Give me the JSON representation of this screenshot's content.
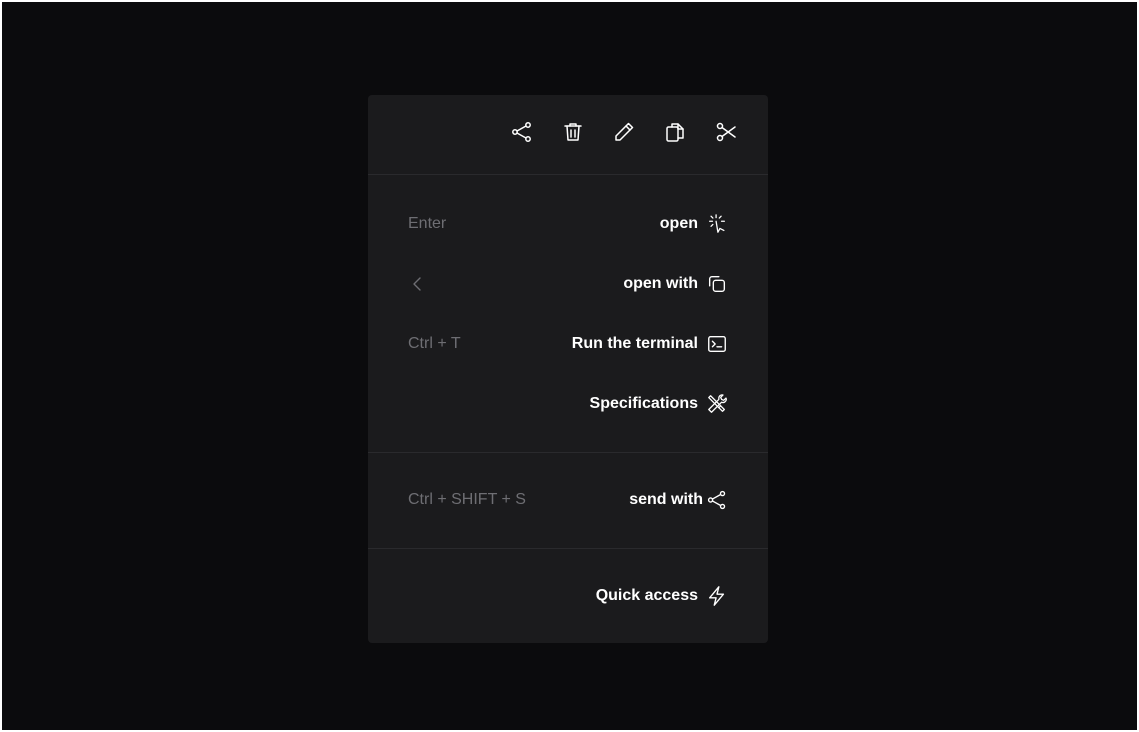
{
  "toolbar": {
    "icons": [
      "share-icon",
      "trash-icon",
      "pencil-icon",
      "copy-icon",
      "scissors-icon"
    ]
  },
  "section_open": {
    "items": [
      {
        "shortcut": "Enter",
        "label": "open",
        "icon": "click-cursor-icon"
      },
      {
        "shortcut": "<",
        "label": "open with",
        "icon": "windows-stack-icon"
      },
      {
        "shortcut": "Ctrl + T",
        "label": "Run the terminal",
        "icon": "terminal-icon"
      },
      {
        "shortcut": "",
        "label": "Specifications",
        "icon": "tools-icon"
      }
    ]
  },
  "section_send": {
    "items": [
      {
        "shortcut": "Ctrl + SHIFT + S",
        "label": "send with",
        "icon": "share-icon"
      }
    ]
  },
  "section_quick": {
    "items": [
      {
        "shortcut": "",
        "label": "Quick access",
        "icon": "lightning-icon"
      }
    ]
  },
  "colors": {
    "background": "#0b0b0d",
    "menu": "#1b1b1d",
    "text": "#ffffff",
    "muted": "#6e6e73",
    "divider": "#2a2a2d"
  }
}
